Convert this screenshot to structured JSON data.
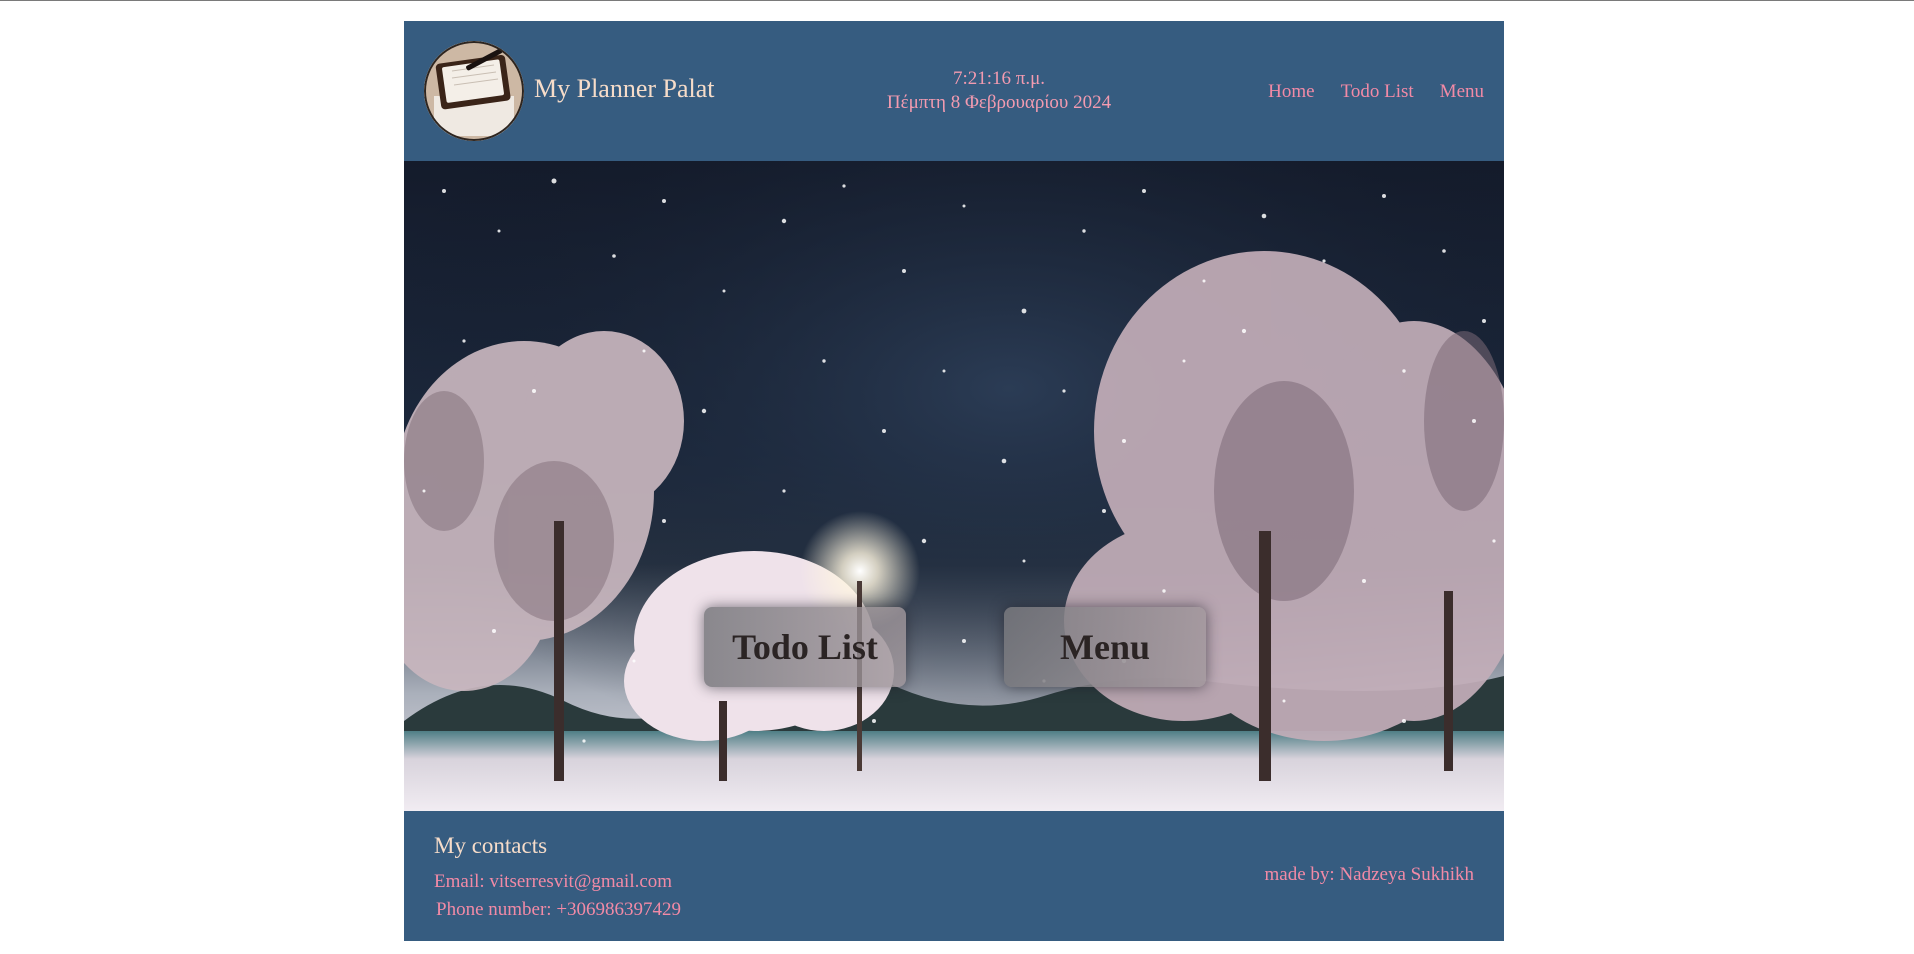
{
  "header": {
    "brand": "My Planner Palat",
    "time": "7:21:16 π.μ.",
    "date": "Πέμπτη 8 Φεβρουαρίου 2024",
    "nav": [
      "Home",
      "Todo List",
      "Menu"
    ]
  },
  "hero": {
    "buttons": [
      "Todo List",
      "Menu"
    ]
  },
  "footer": {
    "title": "My contacts",
    "email": "Email: vitserresvit@gmail.com",
    "phone": "Phone number: +306986397429",
    "made_by": "made by: Nadzeya Sukhikh"
  },
  "colors": {
    "header_bg": "#365c80",
    "link": "#f28aa6",
    "brand_text": "#f6dcc9"
  }
}
